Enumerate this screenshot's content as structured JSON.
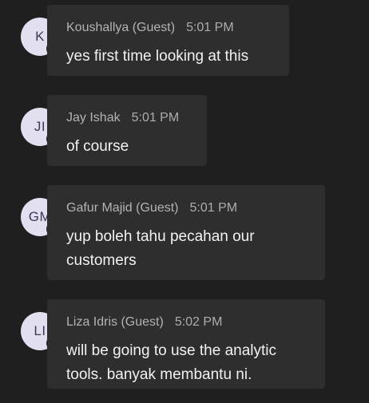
{
  "messages": [
    {
      "initials": "K",
      "status": "guest-offline",
      "author": "Koushallya (Guest)",
      "time": "5:01 PM",
      "text": "yes first time looking at this"
    },
    {
      "initials": "JI",
      "status": "away",
      "author": "Jay Ishak",
      "time": "5:01 PM",
      "text": "of course"
    },
    {
      "initials": "GM",
      "status": "guest-offline",
      "author": "Gafur Majid (Guest)",
      "time": "5:01 PM",
      "text": "yup boleh tahu pecahan our customers"
    },
    {
      "initials": "LI",
      "status": "guest-offline",
      "author": "Liza Idris (Guest)",
      "time": "5:02 PM",
      "text": "will be going to use the analytic tools. banyak membantu ni."
    }
  ],
  "colors": {
    "background": "#1f1f1f",
    "bubble": "#2e2e2e",
    "avatar_bg": "#e1dff0",
    "avatar_text": "#3b3a59",
    "away_status": "#f8b73a"
  }
}
